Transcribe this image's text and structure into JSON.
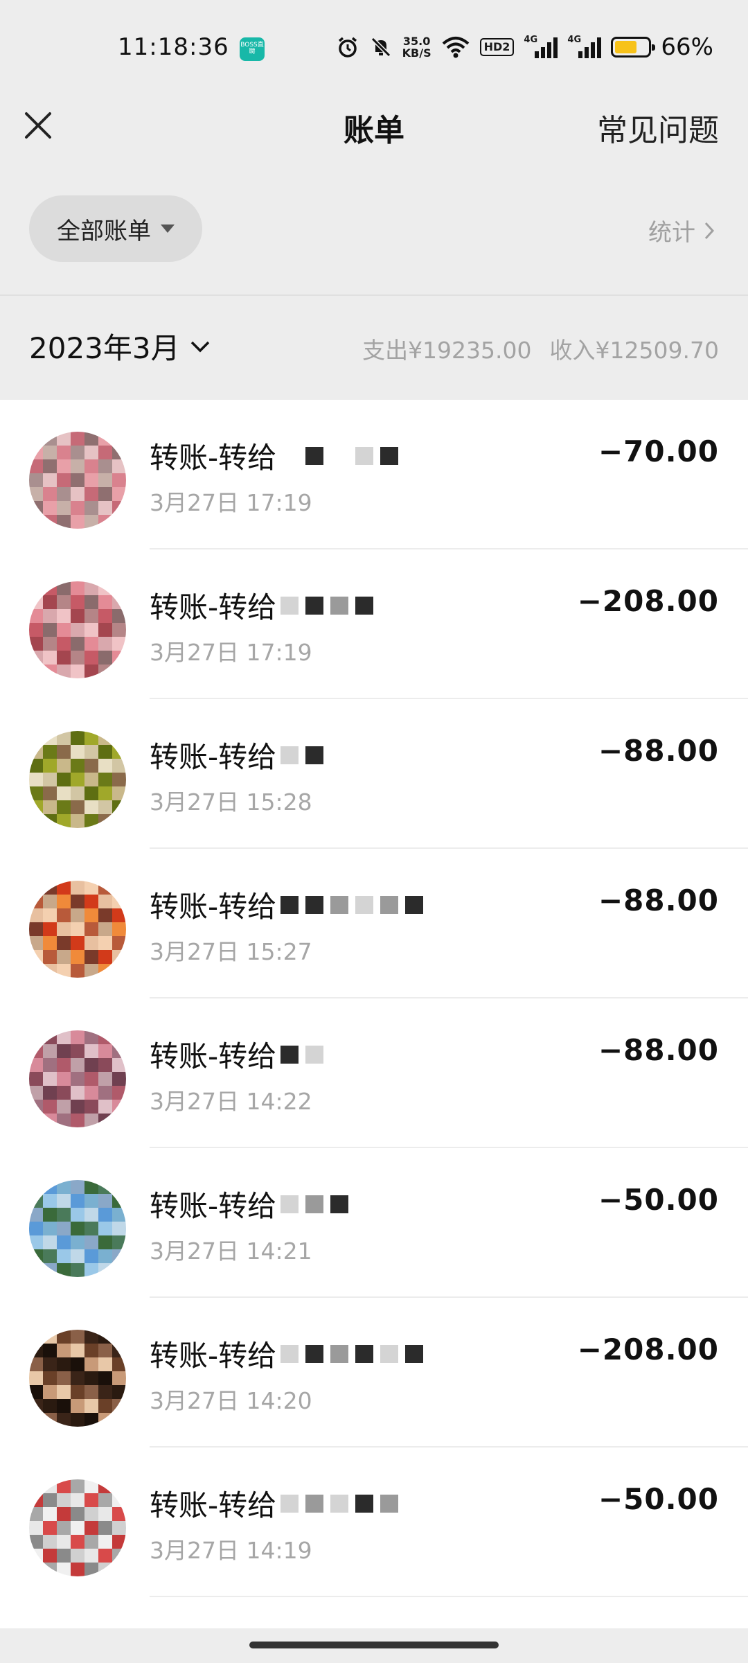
{
  "status_bar": {
    "time": "11:18:36",
    "app_badge": "BOSS直聘",
    "net_speed_value": "35.0",
    "net_speed_unit": "KB/S",
    "hd_label": "HD2",
    "signal_label_1": "4G",
    "signal_label_2": "4G",
    "battery_percent": "66%",
    "battery_level": 0.66
  },
  "nav": {
    "title": "账单",
    "faq_label": "常见问题"
  },
  "filter": {
    "all_bills_label": "全部账单",
    "stats_label": "统计"
  },
  "month": {
    "label": "2023年3月",
    "expense": "支出¥19235.00",
    "income": "收入¥12509.70"
  },
  "transactions": [
    {
      "title": "转账-转给",
      "time": "3月27日 17:19",
      "amount": "−70.00"
    },
    {
      "title": "转账-转给",
      "time": "3月27日 17:19",
      "amount": "−208.00"
    },
    {
      "title": "转账-转给",
      "time": "3月27日 15:28",
      "amount": "−88.00"
    },
    {
      "title": "转账-转给",
      "time": "3月27日 15:27",
      "amount": "−88.00"
    },
    {
      "title": "转账-转给",
      "time": "3月27日 14:22",
      "amount": "−88.00"
    },
    {
      "title": "转账-转给",
      "time": "3月27日 14:21",
      "amount": "−50.00"
    },
    {
      "title": "转账-转给",
      "time": "3月27日 14:20",
      "amount": "−208.00"
    },
    {
      "title": "转账-转给",
      "time": "3月27日 14:19",
      "amount": "−50.00"
    }
  ],
  "colors": {
    "page_bg": "#ededed",
    "list_bg": "#ffffff",
    "muted_text": "#a6a6a6",
    "battery_fill": "#f7c21a"
  },
  "icons": {
    "close": "close-icon",
    "dropdown": "caret-down-icon",
    "chevron": "chevron-right-icon",
    "month_chevron": "chevron-down-icon"
  }
}
